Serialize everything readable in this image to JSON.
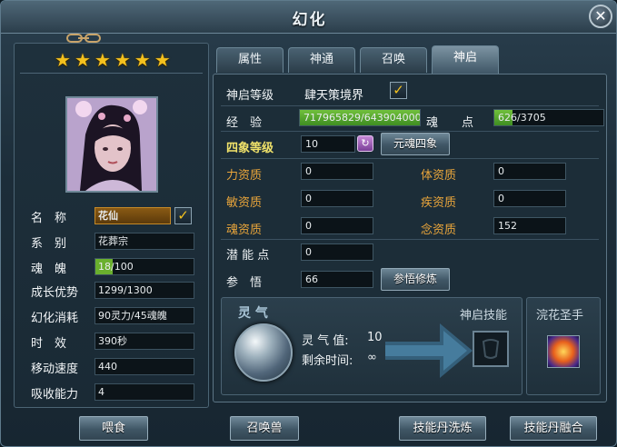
{
  "window": {
    "title": "幻化",
    "close_label": "✕"
  },
  "pet": {
    "stars": [
      "★",
      "★",
      "★",
      "★",
      "★",
      "★"
    ],
    "name_label": "名　称",
    "name_value": "花仙",
    "stats": [
      {
        "label": "系　别",
        "value": "花葬宗"
      },
      {
        "label": "魂　魄",
        "value": "18/100",
        "fill_fraction": 0.18
      },
      {
        "label": "成长优势",
        "value": "1299/1300"
      },
      {
        "label": "幻化消耗",
        "value": "90灵力/45魂魄"
      },
      {
        "label": "时　效",
        "value": "390秒"
      },
      {
        "label": "移动速度",
        "value": "440"
      },
      {
        "label": "吸收能力",
        "value": "4"
      }
    ]
  },
  "tabs": [
    {
      "label": "属性"
    },
    {
      "label": "神通"
    },
    {
      "label": "召唤"
    },
    {
      "label": "神启"
    }
  ],
  "shenqi": {
    "level_label": "神启等级",
    "level_value": "肆天策境界",
    "exp_label": "经　验",
    "exp_value": "717965829/643904000",
    "soul_label": "魂　　点",
    "soul_value": "626/3705",
    "soul_fraction": 0.17,
    "sixiang_label": "四象等级",
    "sixiang_value": "10",
    "sixiang_button": "元魂四象",
    "aptitudes": [
      {
        "label": "力资质",
        "value": "0"
      },
      {
        "label": "体资质",
        "value": "0"
      },
      {
        "label": "敏资质",
        "value": "0"
      },
      {
        "label": "疾资质",
        "value": "0"
      },
      {
        "label": "魂资质",
        "value": "0"
      },
      {
        "label": "念资质",
        "value": "152"
      }
    ],
    "potential_label": "潜 能 点",
    "potential_value": "0",
    "insight_label": "参　悟",
    "insight_value": "66",
    "insight_button": "参悟修炼",
    "lingqi_title": "灵 气",
    "lingqi_value_label": "灵 气 值:",
    "lingqi_value": "10",
    "remaining_label": "剩余时间:",
    "remaining_value": "∞",
    "skill_title": "神启技能",
    "ornament_title": "浣花圣手"
  },
  "bottom_buttons": [
    {
      "label": "喂食"
    },
    {
      "label": "召唤兽"
    },
    {
      "label": "技能丹洗炼"
    },
    {
      "label": "技能丹融合"
    }
  ],
  "colors": {
    "accent_gold": "#e9a53b",
    "star": "#f4c11e",
    "bar_green": "#6ab02e"
  },
  "icons": {
    "close": "close-icon",
    "check": "check-icon",
    "link": "chain-link-icon",
    "arrow": "arrow-right-icon"
  }
}
